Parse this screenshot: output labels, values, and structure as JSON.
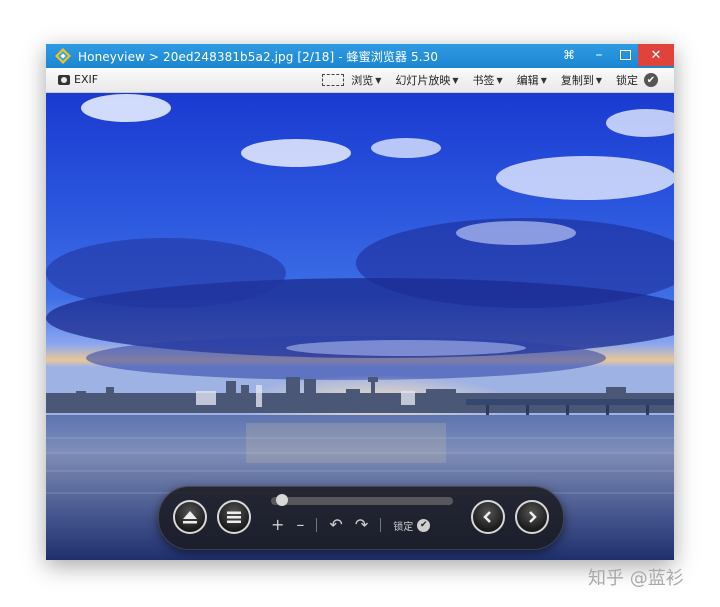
{
  "window": {
    "title": "Honeyview > 20ed248381b5a2.jpg [2/18] - 蜂蜜浏览器 5.30",
    "controls": {
      "pin": "⌘",
      "minimize": "–",
      "close": "✕"
    }
  },
  "menubar": {
    "exif_label": "EXIF",
    "items": [
      {
        "label": "浏览"
      },
      {
        "label": "幻灯片放映"
      },
      {
        "label": "书签"
      },
      {
        "label": "编辑"
      },
      {
        "label": "复制到"
      }
    ],
    "lock_label": "锁定"
  },
  "toolbar": {
    "zoom_in": "+",
    "zoom_out": "–",
    "rotate_left": "↶",
    "rotate_right": "↷",
    "lock_label": "锁定",
    "slider_fraction": 0.03
  },
  "icons": [
    "honeyview-logo-icon",
    "camera-icon",
    "view-mode-icon",
    "lock-check-icon",
    "eject-icon",
    "menu-icon",
    "prev-icon",
    "next-icon"
  ],
  "watermark": "知乎 @蓝衫"
}
